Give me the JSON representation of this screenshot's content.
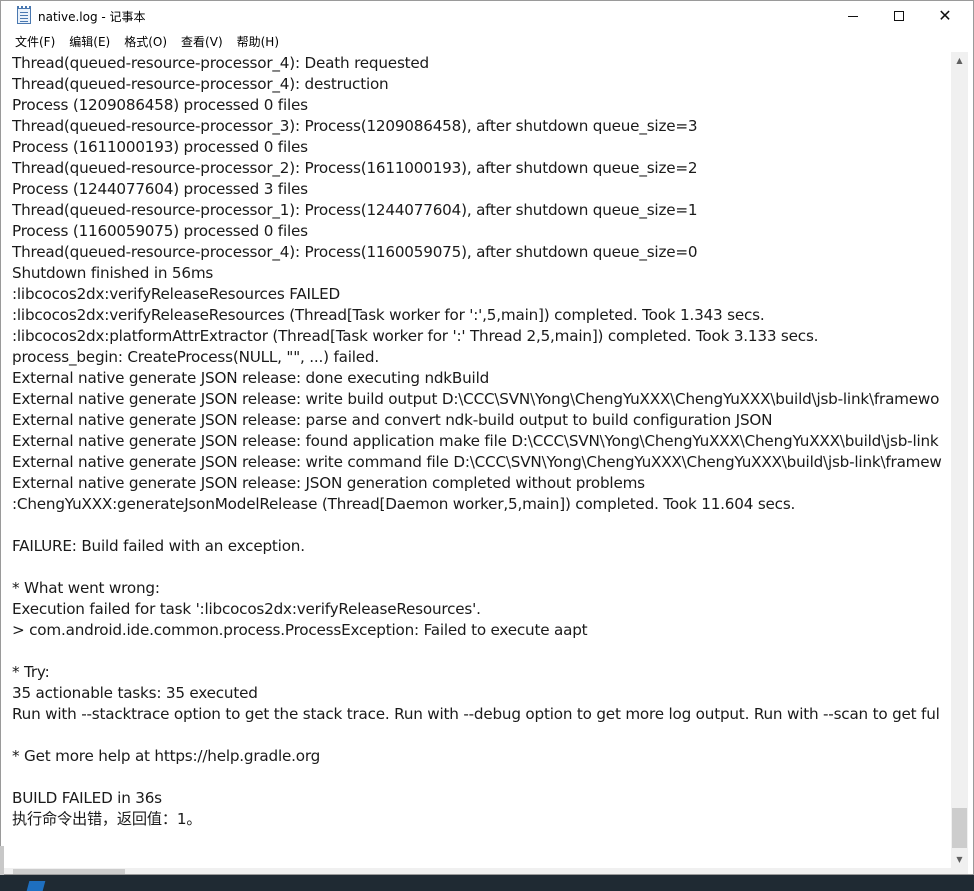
{
  "window": {
    "title": "native.log - 记事本"
  },
  "menu": [
    {
      "label": "文件(F)"
    },
    {
      "label": "编辑(E)"
    },
    {
      "label": "格式(O)"
    },
    {
      "label": "查看(V)"
    },
    {
      "label": "帮助(H)"
    }
  ],
  "editor": {
    "lines": [
      "Thread(queued-resource-processor_4): Death requested",
      "Thread(queued-resource-processor_4): destruction",
      "Process (1209086458) processed 0 files",
      "Thread(queued-resource-processor_3): Process(1209086458), after shutdown queue_size=3",
      "Process (1611000193) processed 0 files",
      "Thread(queued-resource-processor_2): Process(1611000193), after shutdown queue_size=2",
      "Process (1244077604) processed 3 files",
      "Thread(queued-resource-processor_1): Process(1244077604), after shutdown queue_size=1",
      "Process (1160059075) processed 0 files",
      "Thread(queued-resource-processor_4): Process(1160059075), after shutdown queue_size=0",
      "Shutdown finished in 56ms",
      ":libcocos2dx:verifyReleaseResources FAILED",
      ":libcocos2dx:verifyReleaseResources (Thread[Task worker for ':',5,main]) completed. Took 1.343 secs.",
      ":libcocos2dx:platformAttrExtractor (Thread[Task worker for ':' Thread 2,5,main]) completed. Took 3.133 secs.",
      "process_begin: CreateProcess(NULL, \"\", ...) failed.",
      "External native generate JSON release: done executing ndkBuild",
      "External native generate JSON release: write build output D:\\CCC\\SVN\\Yong\\ChengYuXXX\\ChengYuXXX\\build\\jsb-link\\framewo",
      "External native generate JSON release: parse and convert ndk-build output to build configuration JSON",
      "External native generate JSON release: found application make file D:\\CCC\\SVN\\Yong\\ChengYuXXX\\ChengYuXXX\\build\\jsb-link",
      "External native generate JSON release: write command file D:\\CCC\\SVN\\Yong\\ChengYuXXX\\ChengYuXXX\\build\\jsb-link\\framew",
      "External native generate JSON release: JSON generation completed without problems",
      ":ChengYuXXX:generateJsonModelRelease (Thread[Daemon worker,5,main]) completed. Took 11.604 secs.",
      "",
      "FAILURE: Build failed with an exception.",
      "",
      "* What went wrong:",
      "Execution failed for task ':libcocos2dx:verifyReleaseResources'.",
      "> com.android.ide.common.process.ProcessException: Failed to execute aapt",
      "",
      "* Try:",
      "35 actionable tasks: 35 executed",
      "Run with --stacktrace option to get the stack trace. Run with --debug option to get more log output. Run with --scan to get ful",
      "",
      "* Get more help at https://help.gradle.org",
      "",
      "BUILD FAILED in 36s",
      "执行命令出错，返回值：1。"
    ]
  },
  "icons": {
    "app": "notepad-icon",
    "minimize": "minimize-icon",
    "maximize": "maximize-icon",
    "close": "close-icon"
  }
}
